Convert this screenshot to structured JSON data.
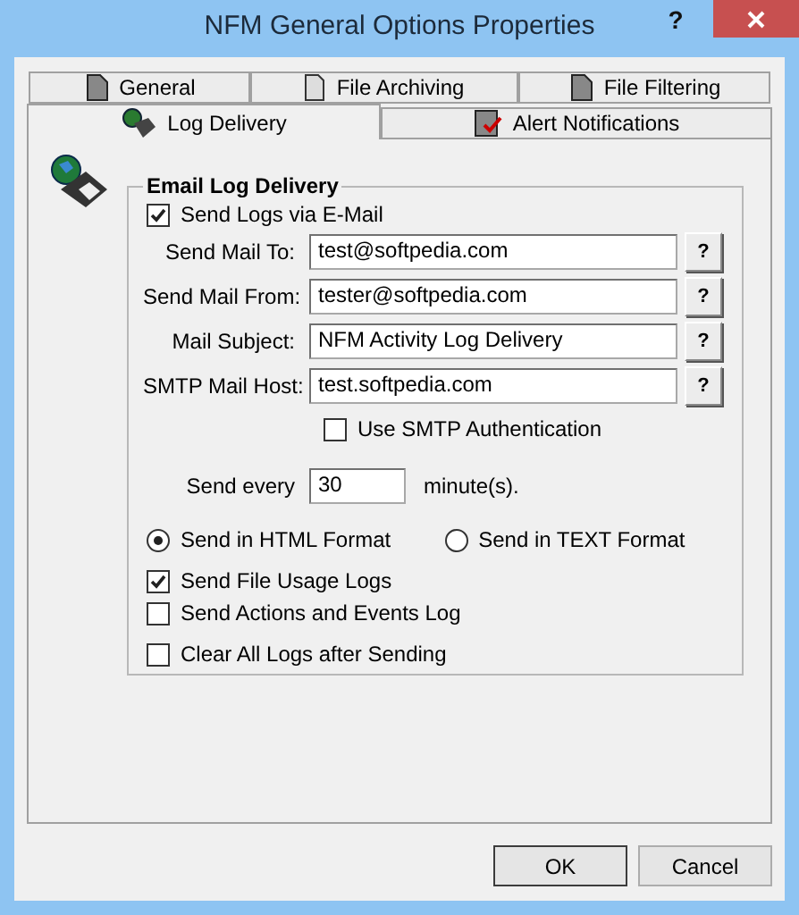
{
  "window": {
    "title": "NFM General Options Properties",
    "help": "?"
  },
  "tab_rows": [
    {
      "tabs": [
        {
          "label": "General",
          "kind": "doc",
          "selected": false
        },
        {
          "label": "File Archiving",
          "kind": "page",
          "selected": false
        },
        {
          "label": "File Filtering",
          "kind": "doc",
          "selected": false
        }
      ]
    },
    {
      "tabs": [
        {
          "label": "Log Delivery",
          "kind": "globe",
          "selected": true
        },
        {
          "label": "Alert Notifications",
          "kind": "check",
          "selected": false
        }
      ]
    }
  ],
  "group": {
    "title": "Email Log Delivery",
    "send_logs": {
      "label": "Send Logs via E-Mail",
      "checked": true
    },
    "fields": [
      {
        "label": "Send Mail To:",
        "value": "test@softpedia.com",
        "help": "?"
      },
      {
        "label": "Send Mail From:",
        "value": "tester@softpedia.com",
        "help": "?"
      },
      {
        "label": "Mail Subject:",
        "value": "NFM Activity Log Delivery",
        "help": "?"
      },
      {
        "label": "SMTP Mail Host:",
        "value": "test.softpedia.com",
        "help": "?"
      }
    ],
    "smtp_auth": {
      "label": "Use SMTP Authentication",
      "checked": false
    },
    "interval": {
      "label": "Send every",
      "value": "30",
      "unit": "minute(s)."
    },
    "formats": [
      {
        "label": "Send in HTML Format",
        "selected": true
      },
      {
        "label": "Send in TEXT Format",
        "selected": false
      }
    ],
    "options": [
      {
        "label": "Send File Usage Logs",
        "checked": true
      },
      {
        "label": "Send Actions and Events Log",
        "checked": false
      },
      {
        "label": "Clear All Logs after Sending",
        "checked": false
      }
    ]
  },
  "buttons": [
    "OK",
    "Cancel"
  ]
}
